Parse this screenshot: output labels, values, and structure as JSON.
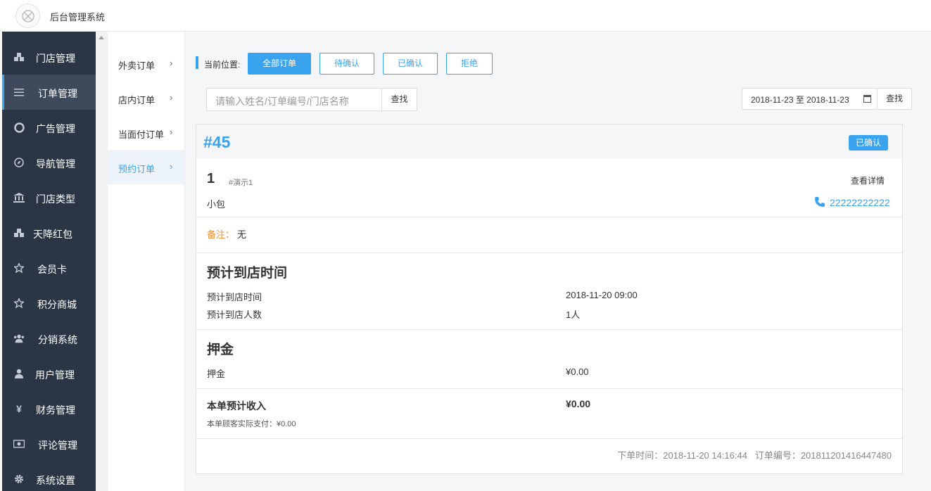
{
  "app": {
    "title": "后台管理系统"
  },
  "sidebar": {
    "items": [
      {
        "label": "门店管理",
        "icon": "cubes-icon"
      },
      {
        "label": "订单管理",
        "icon": "list-icon",
        "active": true
      },
      {
        "label": "广告管理",
        "icon": "lifebuoy-icon"
      },
      {
        "label": "导航管理",
        "icon": "compass-icon"
      },
      {
        "label": "门店类型",
        "icon": "bank-icon"
      },
      {
        "label": "天降红包",
        "icon": "cubes-icon"
      },
      {
        "label": "会员卡",
        "icon": "star-icon"
      },
      {
        "label": "积分商城",
        "icon": "star-icon"
      },
      {
        "label": "分销系统",
        "icon": "users-icon"
      },
      {
        "label": "用户管理",
        "icon": "user-icon"
      },
      {
        "label": "财务管理",
        "icon": "yen-icon"
      },
      {
        "label": "评论管理",
        "icon": "money-icon"
      },
      {
        "label": "系统设置",
        "icon": "gear-icon"
      }
    ]
  },
  "submenu": {
    "items": [
      {
        "label": "外卖订单"
      },
      {
        "label": "店内订单"
      },
      {
        "label": "当面付订单"
      },
      {
        "label": "预约订单",
        "active": true
      }
    ],
    "arrow": "›"
  },
  "filters": {
    "crumb_label": "当前位置:",
    "buttons": [
      "全部订单",
      "待确认",
      "已确认",
      "拒绝"
    ]
  },
  "search": {
    "placeholder": "请输入姓名/订单编号/门店名称",
    "button": "查找",
    "date_range": "2018-11-23 至 2018-11-23",
    "date_button": "查找"
  },
  "order": {
    "number": "#45",
    "status": "已确认",
    "customer_num": "1",
    "customer_tag": "#演示1",
    "customer_name": "小包",
    "detail_link": "查看详情",
    "phone": "22222222222",
    "remark_label": "备注：",
    "remark_value": "无",
    "arrival": {
      "title": "预计到店时间",
      "time_label": "预计到店时间",
      "time_value": "2018-11-20 09:00",
      "people_label": "预计到店人数",
      "people_value": "1人"
    },
    "deposit": {
      "title": "押金",
      "label": "押金",
      "value": "¥0.00"
    },
    "income": {
      "label": "本单预计收入",
      "value": "¥0.00",
      "note": "本单顾客实际支付：¥0.00"
    },
    "footer": {
      "order_time": "下单时间：2018-11-20 14:16:44",
      "order_code": "订单编号：201811201416447480"
    }
  },
  "colors": {
    "accent": "#3aa3ef",
    "sidebar_bg": "#2a3645",
    "remark": "#f08c2c"
  }
}
